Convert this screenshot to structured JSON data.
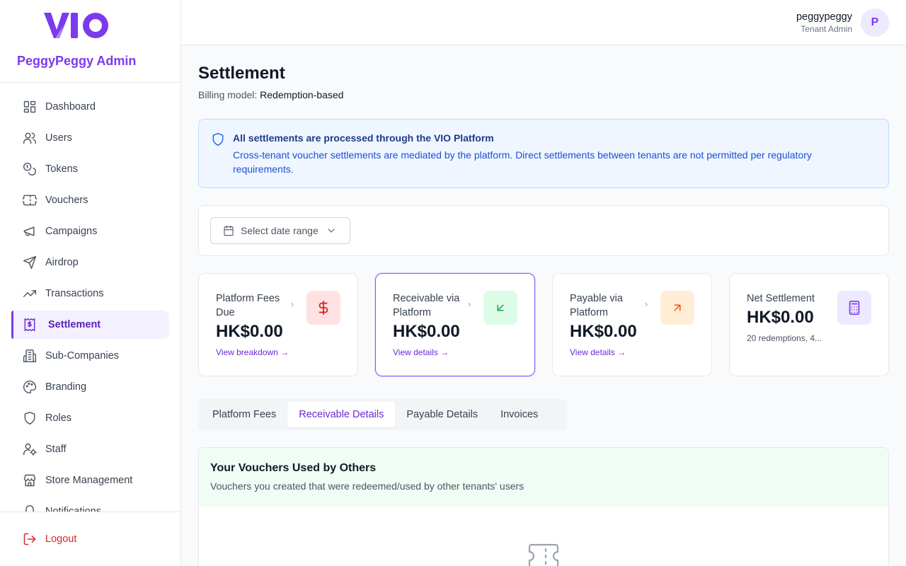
{
  "brand": {
    "logo_text": "VIO",
    "name": "PeggyPeggy Admin",
    "accent": "#7c3aed"
  },
  "sidebar": {
    "items": [
      {
        "label": "Dashboard",
        "icon": "dashboard-icon"
      },
      {
        "label": "Users",
        "icon": "users-icon"
      },
      {
        "label": "Tokens",
        "icon": "coins-icon"
      },
      {
        "label": "Vouchers",
        "icon": "ticket-icon"
      },
      {
        "label": "Campaigns",
        "icon": "megaphone-icon"
      },
      {
        "label": "Airdrop",
        "icon": "send-icon"
      },
      {
        "label": "Transactions",
        "icon": "trending-up-icon"
      },
      {
        "label": "Settlement",
        "icon": "receipt-icon",
        "active": true
      },
      {
        "label": "Sub-Companies",
        "icon": "building-icon"
      },
      {
        "label": "Branding",
        "icon": "palette-icon"
      },
      {
        "label": "Roles",
        "icon": "shield-icon"
      },
      {
        "label": "Staff",
        "icon": "user-cog-icon"
      },
      {
        "label": "Store Management",
        "icon": "store-icon"
      },
      {
        "label": "Notifications",
        "icon": "bell-icon"
      }
    ],
    "logout_label": "Logout"
  },
  "header": {
    "user_name": "peggypeggy",
    "user_role": "Tenant Admin",
    "avatar_initial": "P"
  },
  "page": {
    "title": "Settlement",
    "billing_label": "Billing model:",
    "billing_value": "Redemption-based"
  },
  "info": {
    "title": "All settlements are processed through the VIO Platform",
    "body": "Cross-tenant voucher settlements are mediated by the platform. Direct settlements between tenants are not permitted per regulatory requirements."
  },
  "filter": {
    "date_range_placeholder": "Select date range"
  },
  "cards": [
    {
      "label": "Platform Fees Due",
      "value": "HK$0.00",
      "link": "View breakdown →",
      "icon": "dollar-icon",
      "icon_bg": "#fee2e2",
      "icon_color": "#dc2626"
    },
    {
      "label": "Receivable via Platform",
      "value": "HK$0.00",
      "link": "View details →",
      "icon": "arrow-down-left-icon",
      "icon_bg": "#dcfce7",
      "icon_color": "#16a34a",
      "selected": true
    },
    {
      "label": "Payable via Platform",
      "value": "HK$0.00",
      "link": "View details →",
      "icon": "arrow-up-right-icon",
      "icon_bg": "#ffedd5",
      "icon_color": "#ea580c"
    },
    {
      "label": "Net Settlement",
      "value": "HK$0.00",
      "sub": "20 redemptions, 4...",
      "icon": "calculator-icon",
      "icon_bg": "#ede9fe",
      "icon_color": "#7c3aed"
    }
  ],
  "tabs": [
    {
      "label": "Platform Fees"
    },
    {
      "label": "Receivable Details",
      "active": true
    },
    {
      "label": "Payable Details"
    },
    {
      "label": "Invoices"
    }
  ],
  "panel": {
    "title": "Your Vouchers Used by Others",
    "subtitle": "Vouchers you created that were redeemed/used by other tenants' users"
  }
}
